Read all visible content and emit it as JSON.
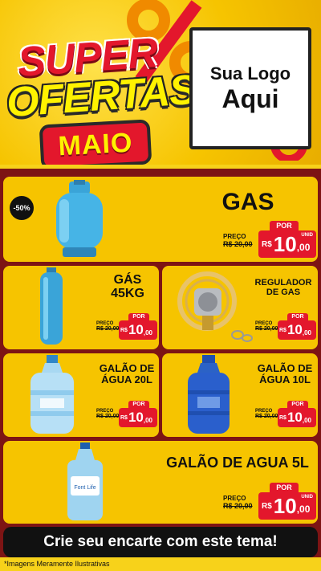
{
  "header": {
    "title_super": "SUPER",
    "title_ofertas": "OFERTAS",
    "title_month": "MAIO",
    "logo_line1": "Sua Logo",
    "logo_line2": "Aqui"
  },
  "products": [
    {
      "name": "GAS",
      "discount": "-50%",
      "preco_label": "PREÇO",
      "old_price": "R$ 20,00",
      "por_label": "POR",
      "currency": "R$",
      "price_int": "10",
      "price_dec": ",00",
      "unit": "UNID"
    },
    {
      "name_l1": "GÁS",
      "name_l2": "45KG",
      "preco_label": "PREÇO",
      "old_price": "R$ 20,00",
      "por_label": "POR",
      "currency": "R$",
      "price_int": "10",
      "price_dec": ",00",
      "unit": "UNID"
    },
    {
      "name_l1": "REGULADOR",
      "name_l2": "DE GAS",
      "preco_label": "PREÇO",
      "old_price": "R$ 20,00",
      "por_label": "POR",
      "currency": "R$",
      "price_int": "10",
      "price_dec": ",00",
      "unit": "UNID"
    },
    {
      "name_l1": "GALÃO DE",
      "name_l2": "ÁGUA 20L",
      "preco_label": "PREÇO",
      "old_price": "R$ 20,00",
      "por_label": "POR",
      "currency": "R$",
      "price_int": "10",
      "price_dec": ",00",
      "unit": "UNID"
    },
    {
      "name_l1": "GALÃO DE",
      "name_l2": "ÁGUA 10L",
      "preco_label": "PREÇO",
      "old_price": "R$ 20,00",
      "por_label": "POR",
      "currency": "R$",
      "price_int": "10",
      "price_dec": ",00",
      "unit": "UNID"
    },
    {
      "name": "GALÃO DE AGUA 5L",
      "preco_label": "PREÇO",
      "old_price": "R$ 20,00",
      "por_label": "POR",
      "currency": "R$",
      "price_int": "10",
      "price_dec": ",00",
      "unit": "UNID",
      "bottle_brand": "Font Life"
    }
  ],
  "cta": {
    "label": "Crie seu encarte com este tema!"
  },
  "footer": {
    "disclaimer": "*Imagens Meramente Ilustrativas"
  },
  "colors": {
    "yellow": "#f6c400",
    "red": "#e3172c",
    "dark_red": "#7d1414",
    "black": "#111111"
  }
}
